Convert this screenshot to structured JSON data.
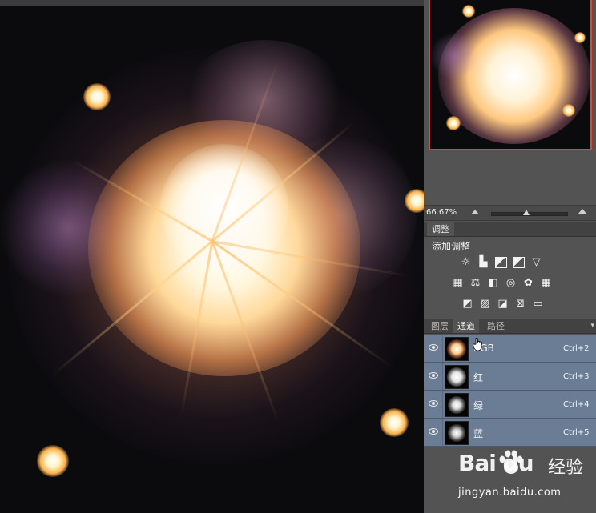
{
  "navigator": {
    "zoom": "66.67%"
  },
  "adjustments": {
    "tab_label": "调整",
    "title": "添加调整"
  },
  "channels": {
    "tabs": [
      "图层",
      "通道",
      "路径"
    ],
    "active_tab": "通道",
    "rows": [
      {
        "name": "RGB",
        "shortcut": "Ctrl+2"
      },
      {
        "name": "红",
        "shortcut": "Ctrl+3"
      },
      {
        "name": "绿",
        "shortcut": "Ctrl+4"
      },
      {
        "name": "蓝",
        "shortcut": "Ctrl+5"
      }
    ]
  },
  "watermark": {
    "logo": "Bai du",
    "brand": "经验",
    "url": "jingyan.baidu.com"
  },
  "colors": {
    "panel_bg": "#535353",
    "row_selected": "#6b7c95",
    "nav_frame": "#d24a3a",
    "canvas_bg": "#0b0b0e"
  }
}
